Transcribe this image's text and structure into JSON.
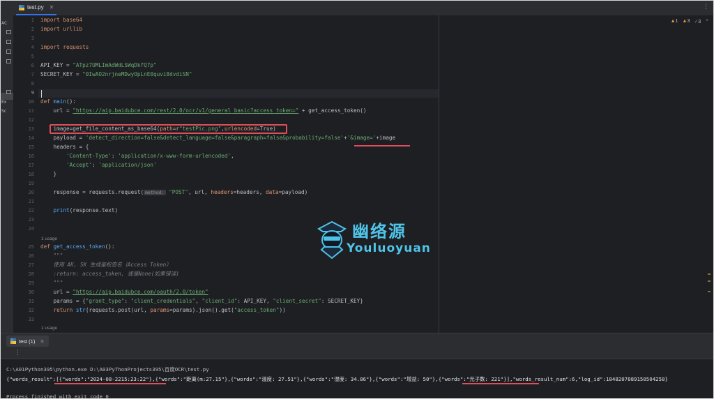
{
  "editor": {
    "tab_label": "test.py",
    "inspections": {
      "warnings": "1",
      "weak_warnings": "3",
      "ok": "3"
    },
    "usage_hint": "1 usage",
    "param_hint_method": "method:"
  },
  "left_panel": {
    "items": [
      "AC",
      "Ex",
      "Sc"
    ]
  },
  "lines": [
    "1",
    "2",
    "3",
    "4",
    "5",
    "6",
    "7",
    "8",
    "9",
    "10",
    "11",
    "12",
    "13",
    "14",
    "15",
    "16",
    "17",
    "18",
    "19",
    "20",
    "21",
    "22",
    "23",
    "24",
    "25",
    "26",
    "27",
    "28",
    "29",
    "30",
    "31",
    "32",
    "33"
  ],
  "code": {
    "l1": "import base64",
    "l2": "import urllib",
    "l4": "import requests",
    "l6a": "API_KEY = ",
    "l6b": "\"ATpz7UMLImAdWdLSWqDkfQ7p\"",
    "l7a": "SECRET_KEY = ",
    "l7b": "\"0IwAO2nrjneMDwyOpLnE0quvi8dvdiSN\"",
    "l10a": "def ",
    "l10b": "main",
    "l10c": "():",
    "l11a": "    url = ",
    "l11b": "\"https://aip.baidubce.com/rest/2.0/ocr/v1/general_basic?access_token=\"",
    "l11c": " + get_access_token()",
    "l13a": "    image=get_file_content_as_base64(",
    "l13b": "path",
    "l13c": "=r",
    "l13d": "\"testPic.png\"",
    "l13e": ",",
    "l13f": "urlencoded",
    "l13g": "=True)",
    "l14a": "    payload = ",
    "l14b": "'detect_direction=false&detect_language=false&paragraph=false&probability=false'",
    "l14c": "+",
    "l14d": "'&image='",
    "l14e": "+image",
    "l15": "    headers = {",
    "l16a": "        ",
    "l16b": "'Content-Type'",
    "l16c": ": ",
    "l16d": "'application/x-www-form-urlencoded'",
    "l16e": ",",
    "l17a": "        ",
    "l17b": "'Accept'",
    "l17c": ": ",
    "l17d": "'application/json'",
    "l18": "    }",
    "l20a": "    response = requests.request(",
    "l20b": "\"POST\"",
    "l20c": ", url, ",
    "l20d": "headers",
    "l20e": "=headers, ",
    "l20f": "data",
    "l20g": "=payload)",
    "l22a": "    ",
    "l22b": "print",
    "l22c": "(response.text)",
    "l25a": "def ",
    "l25b": "get_access_token",
    "l25c": "():",
    "l26": "    \"\"\"",
    "l27": "    使用 AK, SK 生成鉴权签名（Access Token）",
    "l28": "    :return: access_token, 或是None(如果错误)",
    "l29": "    \"\"\"",
    "l30a": "    url = ",
    "l30b": "\"https://aip.baidubce.com/oauth/2.0/token\"",
    "l31a": "    params = {",
    "l31b": "\"grant_type\"",
    "l31c": ": ",
    "l31d": "\"client_credentials\"",
    "l31e": ", ",
    "l31f": "\"client_id\"",
    "l31g": ": API_KEY, ",
    "l31h": "\"client_secret\"",
    "l31i": ": SECRET_KEY}",
    "l32a": "    return ",
    "l32b": "str",
    "l32c": "(requests.post(url, ",
    "l32d": "params",
    "l32e": "=params).json().get(",
    "l32f": "\"access_token\"",
    "l32g": "))"
  },
  "run_panel": {
    "tab_label": "test (1)",
    "command": "C:\\A01Python395\\python.exe D:\\A03PyThonProjects395\\百度OCR\\test.py",
    "output": "{\"words_result\":[{\"words\":\"2024-08-2215:23:22\"},{\"words\":\"距离(m:27.15\"},{\"words\":\"温度: 27.51\"},{\"words\":\"湿度: 34.86\"},{\"words\":\"增益: 50\"},{\"words\":\"光子数: 221\"}],\"words_result_num\":6,\"log_id\":1848207889150504258}",
    "finish": "Process finished with exit code 0"
  },
  "watermark": {
    "title": "幽络源",
    "subtitle": "Youluoyuan"
  },
  "colors": {
    "accent": "#3574f0",
    "annotation_red": "#e14d5a",
    "watermark": "#4fc3e8"
  }
}
